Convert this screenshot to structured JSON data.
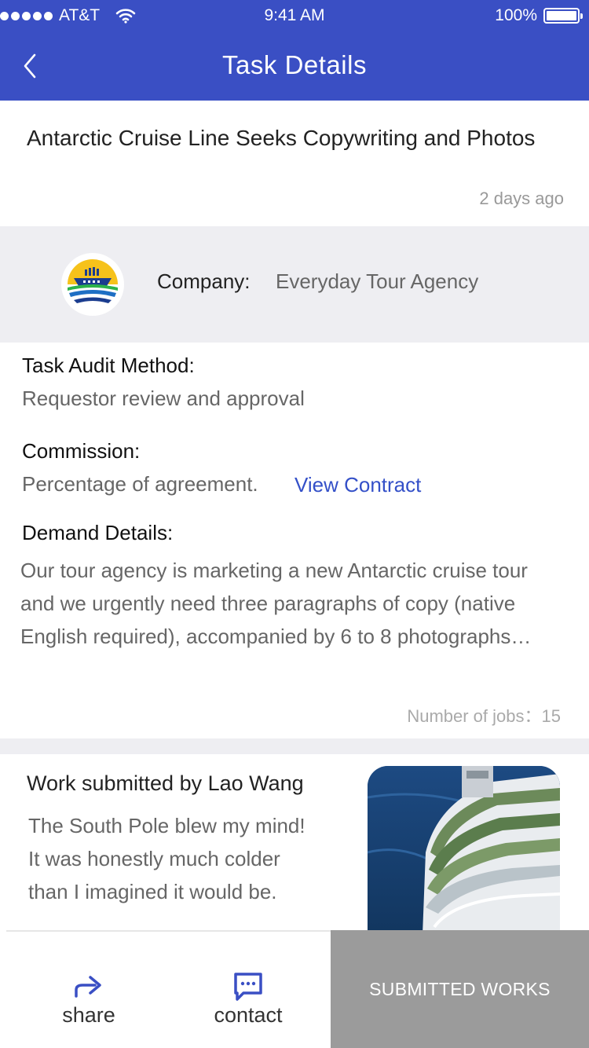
{
  "status_bar": {
    "carrier": "AT&T",
    "time": "9:41 AM",
    "battery": "100%"
  },
  "nav": {
    "title": "Task Details",
    "back_icon": "chevron-left-icon"
  },
  "task": {
    "title": "Antarctic Cruise Line Seeks Copywriting and Photos",
    "posted": "2 days ago"
  },
  "company": {
    "label": "Company:",
    "name": "Everyday Tour Agency"
  },
  "details": {
    "audit_label": "Task Audit Method:",
    "audit_value": "Requestor review and approval",
    "commission_label": "Commission:",
    "commission_value": "Percentage of agreement.",
    "contract_link": "View Contract",
    "demand_label": "Demand Details:",
    "demand_lines": [
      "Our tour agency is marketing a new Antarctic cruise tour",
      "and we urgently need three paragraphs of copy (native",
      "English required), accompanied by 6 to 8 photographs…"
    ],
    "jobs_label": "Number of jobs：",
    "jobs_count": "15"
  },
  "work": {
    "title": "Work submitted by Lao Wang",
    "lines": [
      "The South Pole blew my mind!",
      "It was honestly much colder",
      "than I imagined it would be."
    ]
  },
  "bottom_bar": {
    "share_label": "share",
    "contact_label": "contact",
    "submitted_label": "SUBMITTED WORKS"
  },
  "colors": {
    "brand": "#3a4fc4",
    "link": "#3450c8",
    "button_gray": "#9b9b9b"
  }
}
